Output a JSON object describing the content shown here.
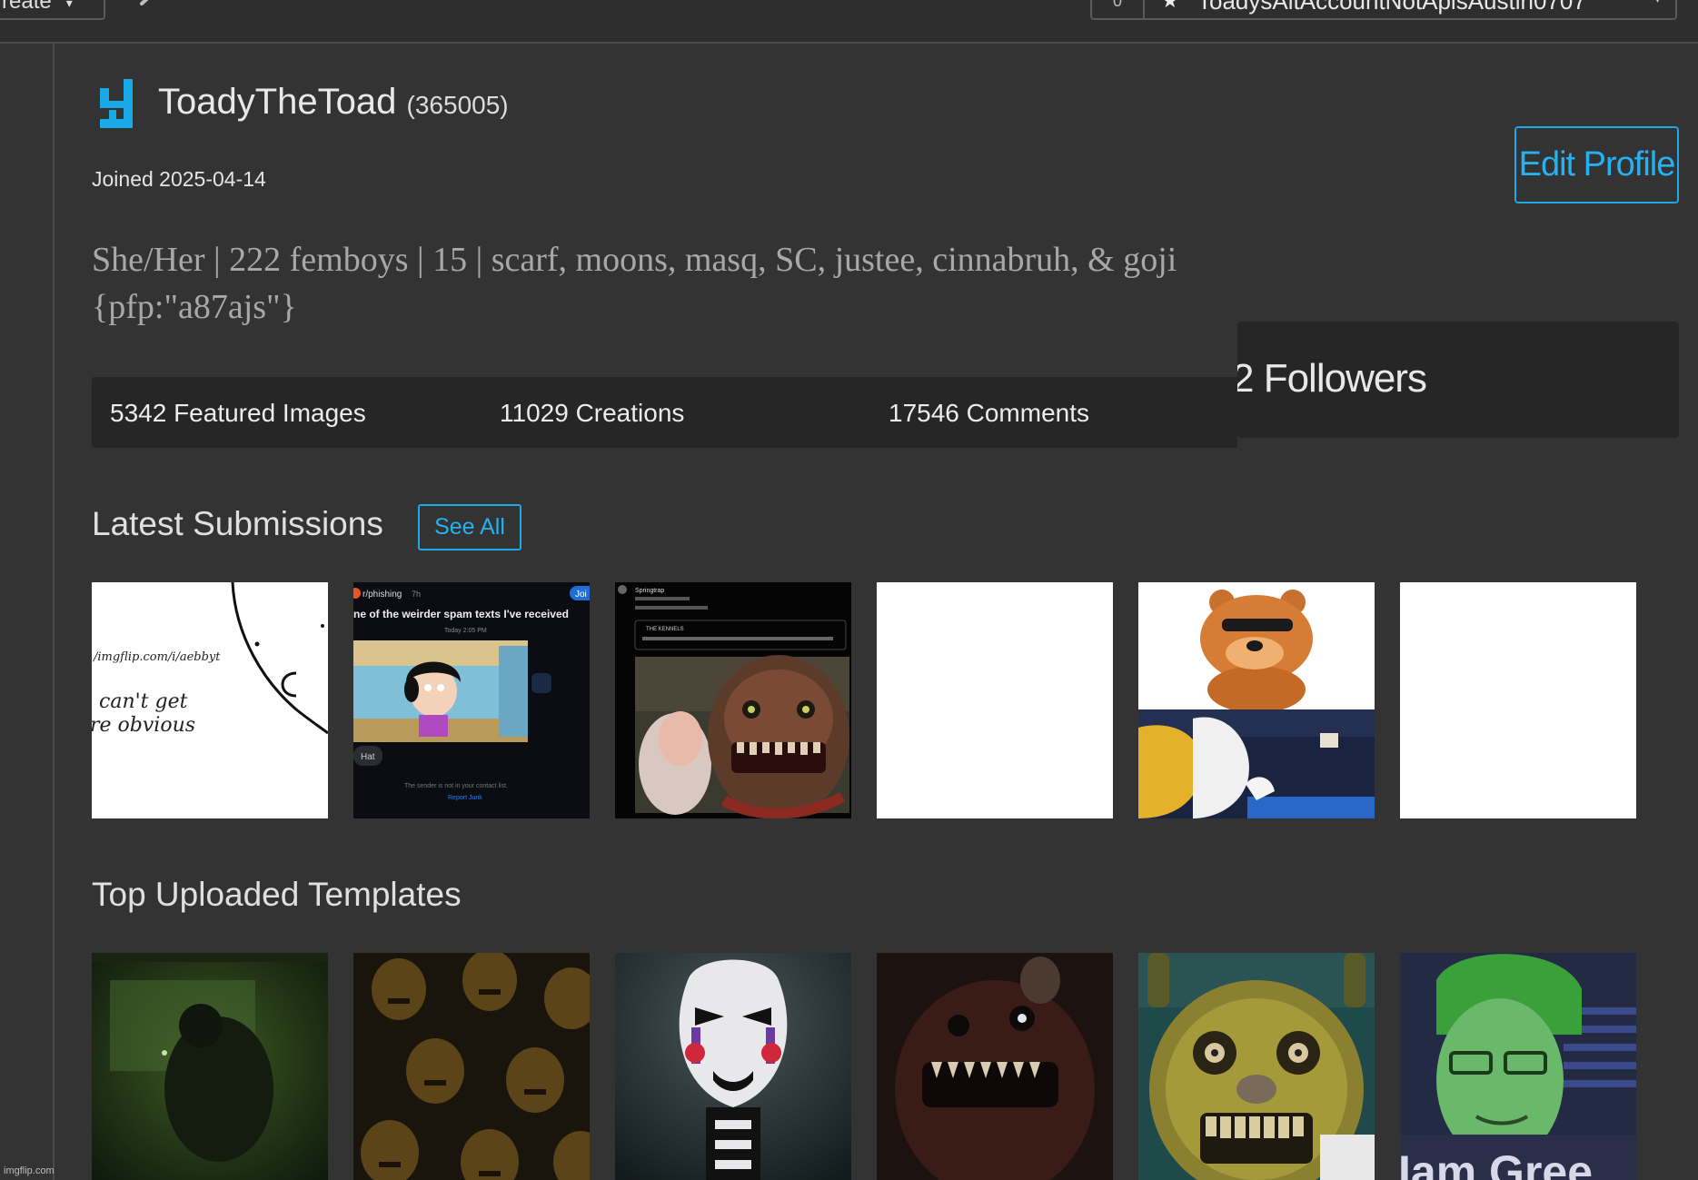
{
  "topbar": {
    "create_label": "reate",
    "account_name": "ToadysAltAccountNotApisAustin0707",
    "bell_count": "0"
  },
  "profile": {
    "username": "ToadyTheToad",
    "user_id": "(365005)",
    "joined": "Joined 2025-04-14",
    "edit_label": "Edit Profile",
    "bio_line1": "She/Her | 222 femboys | 15 | scarf, moons, masq, SC, justee, cinnabruh, & goji",
    "bio_line2": "{pfp:\"a87ajs\"}"
  },
  "stats": {
    "featured": "5342 Featured Images",
    "creations": "11029 Creations",
    "comments": "17546 Comments",
    "followers": "2 Followers"
  },
  "latest": {
    "title": "Latest Submissions",
    "see_all": "See All",
    "thumb1_line1": "/imgflip.com/i/aebbyt",
    "thumb1_line2": "can't get",
    "thumb1_line3": "re obvious",
    "thumb2_user": "r/phishing",
    "thumb2_time": "7h",
    "thumb2_join": "Joi",
    "thumb2_title": "ne of the weirder spam texts I've received",
    "thumb2_date": "Today 2:05 PM",
    "thumb2_tag": "Hat",
    "thumb2_sender": "The sender is not in your contact list.",
    "thumb2_report": "Report Junk",
    "thumb3_user": "Springtrap",
    "thumb3_kennels": "THE KENNELS"
  },
  "templates": {
    "title": "Top Uploaded Templates",
    "thumb6_text": "Iam Gree"
  },
  "footer": {
    "watermark": "imgflip.com"
  },
  "colors": {
    "background": "#333333",
    "panel": "#262626",
    "accent": "#25b2f2",
    "avatar": "#18a9e6"
  }
}
